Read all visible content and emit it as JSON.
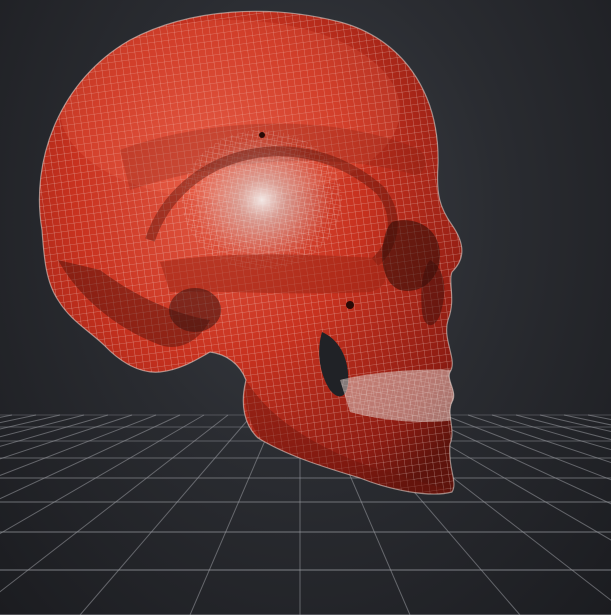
{
  "viewport": {
    "background_color": "#2a2c31",
    "grid_color": "#9a9ca2",
    "model": {
      "name": "skull",
      "display_mode": "wireframe-on-shaded",
      "surface_color": "#c8321f",
      "wire_color": "#e9d6d0"
    }
  }
}
